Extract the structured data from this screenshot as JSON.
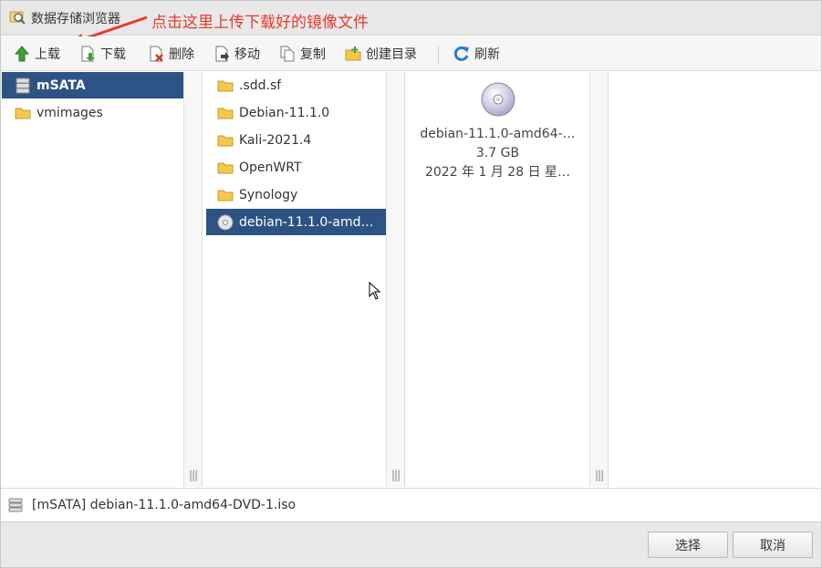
{
  "window": {
    "title": "数据存储浏览器"
  },
  "annotation": {
    "text": "点击这里上传下载好的镜像文件"
  },
  "toolbar": {
    "upload": "上载",
    "download": "下载",
    "delete": "删除",
    "move": "移动",
    "copy": "复制",
    "mkdir": "创建目录",
    "refresh": "刷新"
  },
  "datastores": [
    {
      "label": "mSATA",
      "icon": "datastore-icon",
      "selected": true
    },
    {
      "label": "vmimages",
      "icon": "folder-icon",
      "selected": false
    }
  ],
  "files": [
    {
      "label": ".sdd.sf",
      "icon": "folder-icon"
    },
    {
      "label": "Debian-11.1.0",
      "icon": "folder-icon"
    },
    {
      "label": "Kali-2021.4",
      "icon": "folder-icon"
    },
    {
      "label": "OpenWRT",
      "icon": "folder-icon"
    },
    {
      "label": "Synology",
      "icon": "folder-icon"
    },
    {
      "label": "debian-11.1.0-amd…",
      "icon": "disc-icon",
      "selected": true
    }
  ],
  "preview": {
    "name": "debian-11.1.0-amd64-…",
    "size": "3.7 GB",
    "date": "2022 年 1 月 28 日 星…"
  },
  "status": {
    "path": "[mSATA] debian-11.1.0-amd64-DVD-1.iso"
  },
  "footer": {
    "select": "选择",
    "cancel": "取消"
  },
  "colors": {
    "selection": "#2c5383",
    "annotation": "#e63b2e",
    "folder": "#f2c94c"
  }
}
